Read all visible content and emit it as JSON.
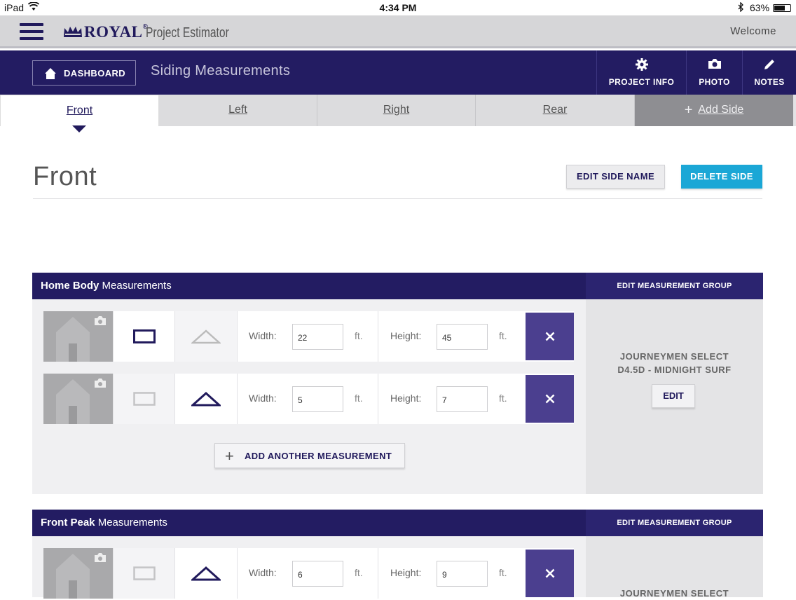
{
  "status_bar": {
    "device": "iPad",
    "time": "4:34 PM",
    "battery": "63%"
  },
  "app": {
    "brand": "ROYAL",
    "registered": "®",
    "product": "Project Estimator",
    "welcome": "Welcome"
  },
  "nav": {
    "dashboard_label": "DASHBOARD",
    "page_title": "Siding Measurements",
    "project_info_label": "PROJECT INFO",
    "photo_label": "PHOTO",
    "notes_label": "NOTES"
  },
  "tabs": {
    "front": "Front",
    "left": "Left",
    "right": "Right",
    "rear": "Rear",
    "add_side": "Add Side"
  },
  "side": {
    "title": "Front",
    "edit_name_label": "EDIT SIDE NAME",
    "delete_label": "DELETE SIDE"
  },
  "groups": [
    {
      "name_bold": "Home Body",
      "name_rest": " Measurements",
      "edit_group_label": "EDIT MEASUREMENT GROUP",
      "product_line1": "JOURNEYMEN SELECT",
      "product_line2": "D4.5D - MIDNIGHT SURF",
      "edit_label": "EDIT",
      "add_label": "ADD ANOTHER MEASUREMENT",
      "rows": [
        {
          "shape": "rectangle",
          "width_label": "Width:",
          "width": "22",
          "width_unit": "ft.",
          "height_label": "Height:",
          "height": "45",
          "height_unit": "ft."
        },
        {
          "shape": "triangle",
          "width_label": "Width:",
          "width": "5",
          "width_unit": "ft.",
          "height_label": "Height:",
          "height": "7",
          "height_unit": "ft."
        }
      ]
    },
    {
      "name_bold": "Front Peak",
      "name_rest": " Measurements",
      "edit_group_label": "EDIT MEASUREMENT GROUP",
      "product_line1": "JOURNEYMEN SELECT",
      "rows": [
        {
          "shape": "triangle",
          "width_label": "Width:",
          "width": "6",
          "width_unit": "ft.",
          "height_label": "Height:",
          "height": "9",
          "height_unit": "ft."
        }
      ]
    }
  ],
  "colors": {
    "navy": "#231c62",
    "accent_blue": "#1ba7d6",
    "delete_purple": "#4b3f8f"
  }
}
